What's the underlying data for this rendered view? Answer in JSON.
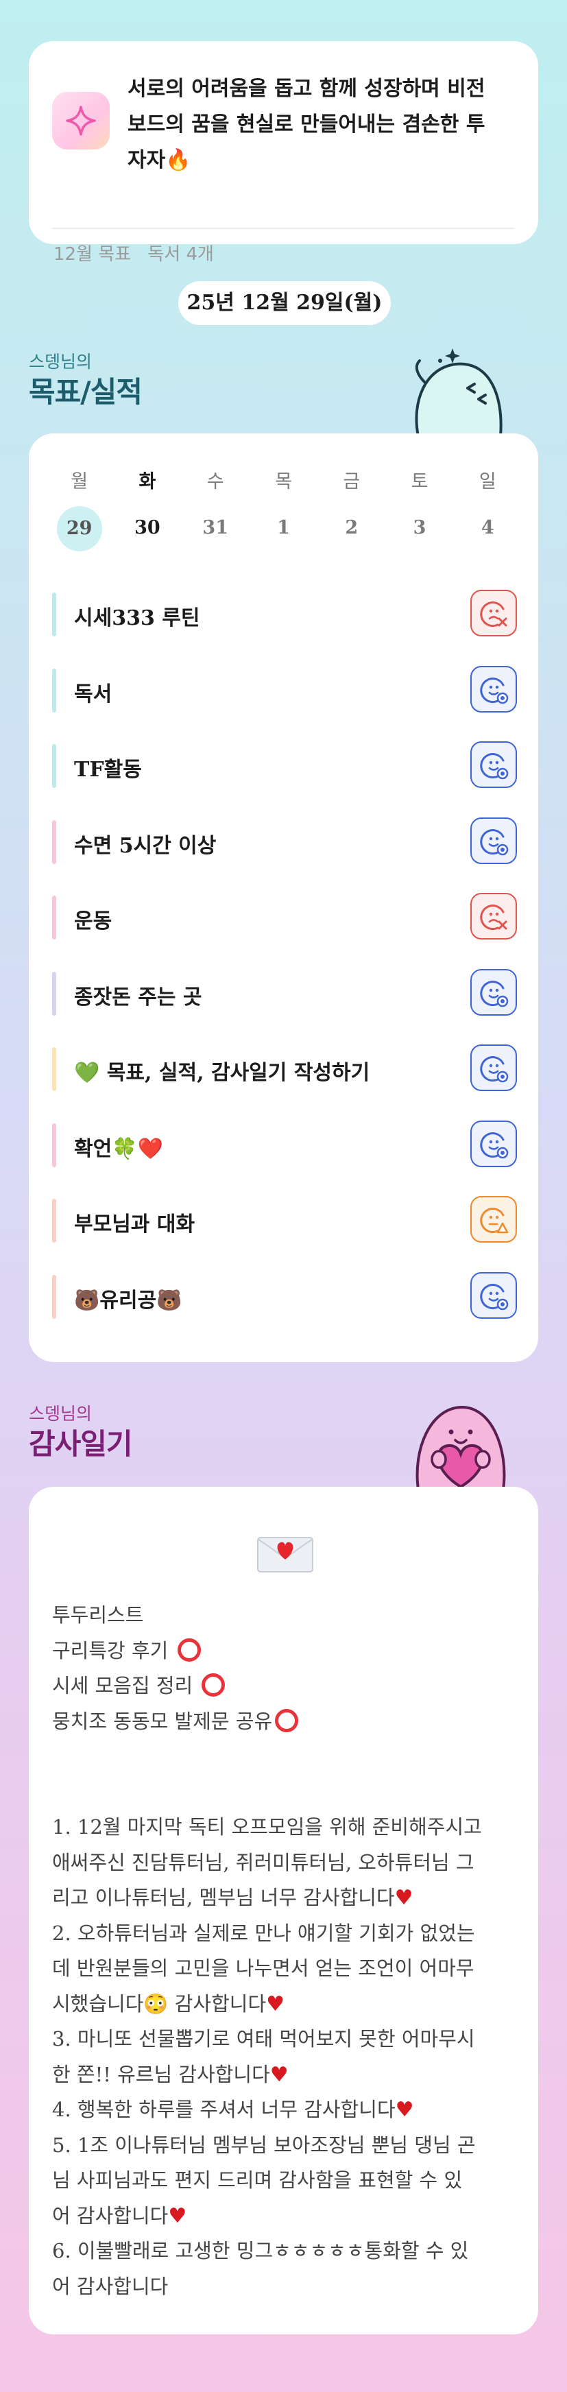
{
  "intro": {
    "line1": "서로의 어려움을 돕고 함께 성장하며 비전",
    "line2": "보드의 꿈을 현실로 만들어내는 겸손한 투",
    "line3": "자자🔥",
    "meta_goal": "12월 목표",
    "meta_reading": "독서 4개"
  },
  "date_label": "25년 12월 29일(월)",
  "goals_section": {
    "subtitle": "스뎅님의",
    "title": "목표/실적"
  },
  "week": {
    "days": [
      "월",
      "화",
      "수",
      "목",
      "금",
      "토",
      "일"
    ],
    "dates": [
      "29",
      "30",
      "31",
      "1",
      "2",
      "3",
      "4"
    ]
  },
  "tasks": [
    {
      "label": "시세333 루틴",
      "bar_color": "#bfe9ea",
      "status": "fail"
    },
    {
      "label": "독서",
      "bar_color": "#bfe9ea",
      "status": "done"
    },
    {
      "label": "TF활동",
      "bar_color": "#bfe9ea",
      "status": "done"
    },
    {
      "label": "수면 5시간 이상",
      "bar_color": "#f6c6dc",
      "status": "done"
    },
    {
      "label": "운동",
      "bar_color": "#f6c6dc",
      "status": "fail"
    },
    {
      "label": "종잣돈 주는 곳",
      "bar_color": "#d9d3f1",
      "status": "done"
    },
    {
      "label": "💚 목표, 실적, 감사일기 작성하기",
      "bar_color": "#fbe3b4",
      "status": "done"
    },
    {
      "label": "확언🍀❤️",
      "bar_color": "#f6c6dc",
      "status": "done"
    },
    {
      "label": "부모님과 대화",
      "bar_color": "#f8d0c6",
      "status": "warn"
    },
    {
      "label": "🐻유리공🐻",
      "bar_color": "#f8d0c6",
      "status": "done"
    }
  ],
  "status_colors": {
    "done": "#3e64d6",
    "fail": "#e0534f",
    "warn": "#ef8a2b"
  },
  "gratitude_section": {
    "subtitle": "스뎅님의",
    "title": "감사일기"
  },
  "gratitude": {
    "todo_title": "투두리스트",
    "todo_1": "구리특강 후기",
    "todo_2": "시세 모음집 정리",
    "todo_3": "뭉치조 동동모 발제문 공유",
    "p1a": "1. 12월 마지막 독티 오프모임을 위해 준비해주시고",
    "p1b": "애써주신 진담튜터님, 쥐러미튜터님, 오하튜터님 그",
    "p1c": "리고 이나튜터님, 멤부님 너무 감사합니다",
    "p2a": "2. 오하튜터님과 실제로 만나 얘기할 기회가 없었는",
    "p2b": "데 반원분들의 고민을 나누면서 얻는 조언이 어마무",
    "p2c": "시했습니다😳 감사합니다",
    "p3a": "3. 마니또 선물뽑기로 여태 먹어보지 못한 어마무시",
    "p3b": "한 쫀!! 유르님 감사합니다",
    "p4a": "4. 행복한 하루를 주셔서 너무 감사합니다",
    "p5a": "5. 1조 이나튜터님 멤부님 보아조장님 뿐님 댕님 곤",
    "p5b": "님 사피님과도 편지 드리며 감사함을 표현할 수 있",
    "p5c": "어 감사합니다",
    "p6a": "6. 이불빨래로 고생한 밍그ㅎㅎㅎㅎㅎ통화할 수 있",
    "p6b": "어 감사합니다"
  }
}
